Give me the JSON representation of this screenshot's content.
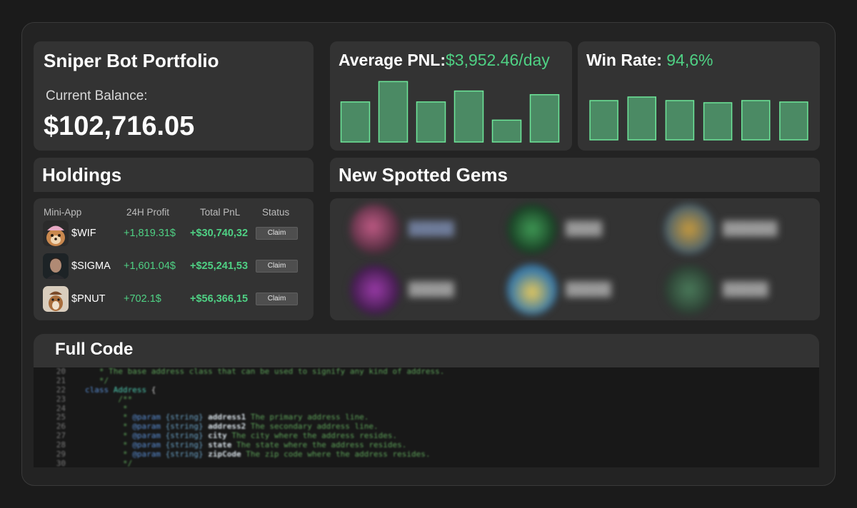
{
  "portfolio": {
    "title": "Sniper Bot Portfolio",
    "balance_label": "Current Balance:",
    "balance_value": "$102,716.05"
  },
  "pnl": {
    "label": "Average PNL:",
    "value": "$3,952.46/day",
    "chart_data": {
      "type": "bar",
      "categories": [
        "",
        "",
        "",
        "",
        "",
        ""
      ],
      "values": [
        55,
        83,
        55,
        70,
        30,
        65
      ],
      "ylim": [
        0,
        100
      ]
    }
  },
  "winrate": {
    "label": "Win Rate:",
    "value": "94,6%",
    "chart_data": {
      "type": "bar",
      "categories": [
        "",
        "",
        "",
        "",
        "",
        ""
      ],
      "values": [
        55,
        60,
        55,
        52,
        55,
        53
      ],
      "ylim": [
        0,
        100
      ]
    }
  },
  "holdings": {
    "title": "Holdings",
    "columns": [
      "Mini-App",
      "24H Profit",
      "Total PnL",
      "Status"
    ],
    "rows": [
      {
        "ticker": "$WIF",
        "profit": "+1,819.31$",
        "total": "+$30,740,32",
        "status": "Claim"
      },
      {
        "ticker": "$SIGMA",
        "profit": "+1,601.04$",
        "total": "+$25,241,53",
        "status": "Claim"
      },
      {
        "ticker": "$PNUT",
        "profit": "+702.1$",
        "total": "+$56,366,15",
        "status": "Claim"
      }
    ]
  },
  "gems": {
    "title": "New Spotted Gems"
  },
  "code": {
    "title": "Full Code",
    "lines": [
      {
        "n": "20",
        "t": "   * The base address class that can be used to signify any kind of address."
      },
      {
        "n": "21",
        "t": "   */"
      },
      {
        "n": "22",
        "t": "class Address {"
      },
      {
        "n": "23",
        "t": "       /**"
      },
      {
        "n": "24",
        "t": "        *"
      },
      {
        "n": "25",
        "t": "        * @param {string} address1 The primary address line."
      },
      {
        "n": "26",
        "t": "        * @param {string} address2 The secondary address line."
      },
      {
        "n": "27",
        "t": "        * @param {string} city The city where the address resides."
      },
      {
        "n": "28",
        "t": "        * @param {string} state The state where the address resides."
      },
      {
        "n": "29",
        "t": "        * @param {string} zipCode The zip code where the address resides."
      },
      {
        "n": "30",
        "t": "        */"
      }
    ]
  }
}
